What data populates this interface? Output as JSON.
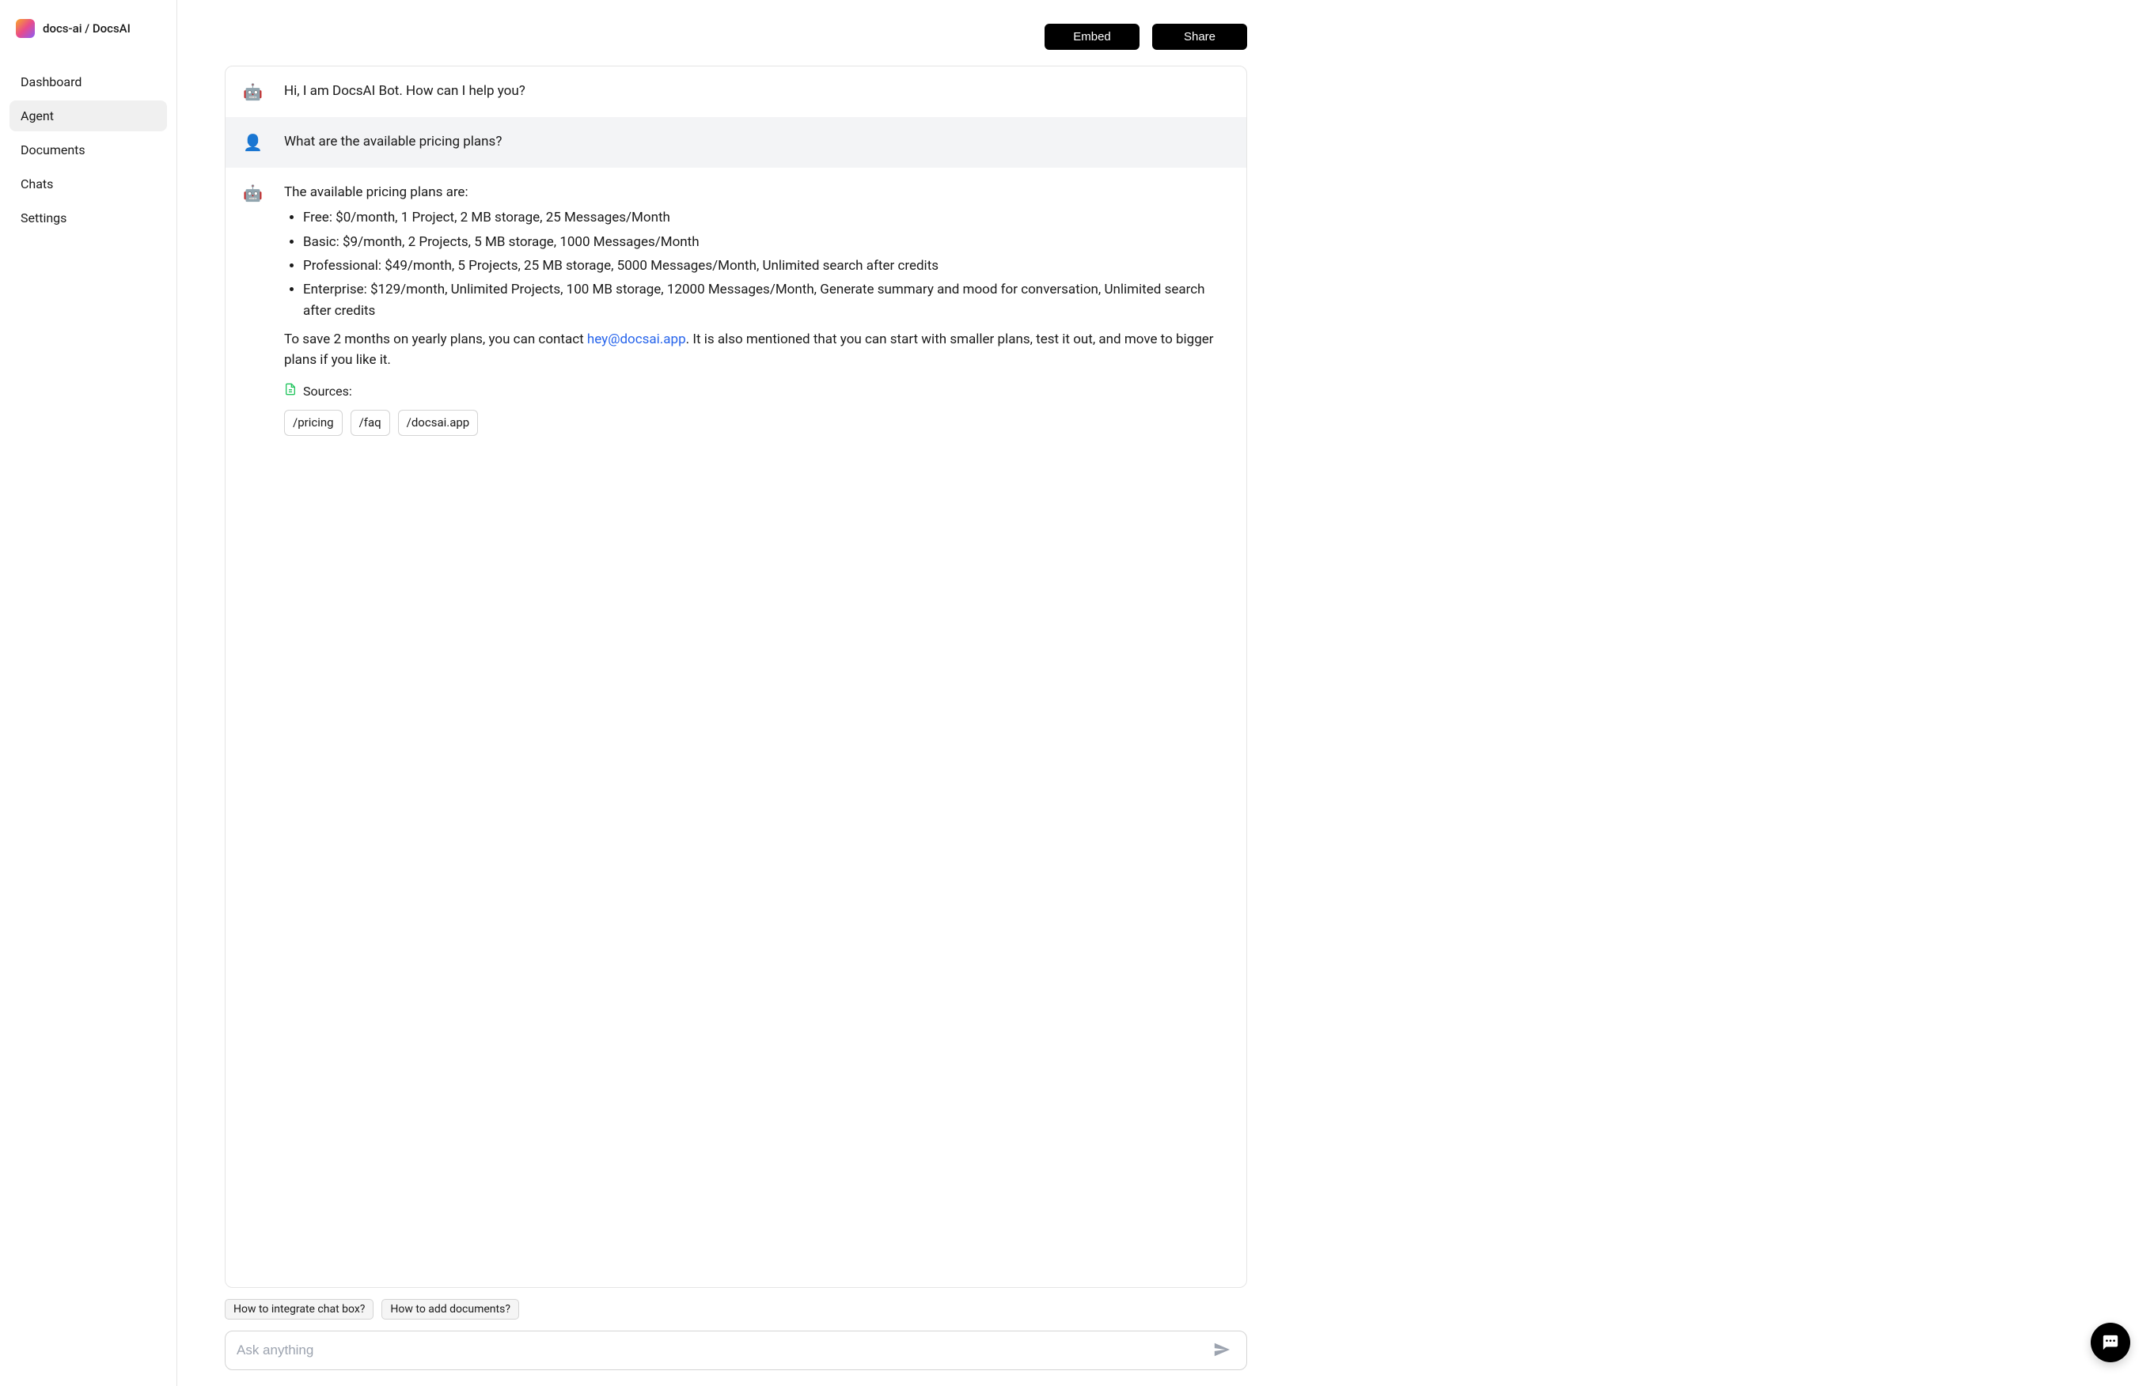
{
  "header": {
    "breadcrumb": "docs-ai / DocsAI"
  },
  "sidebar": {
    "items": [
      {
        "label": "Dashboard",
        "active": false
      },
      {
        "label": "Agent",
        "active": true
      },
      {
        "label": "Documents",
        "active": false
      },
      {
        "label": "Chats",
        "active": false
      },
      {
        "label": "Settings",
        "active": false
      }
    ]
  },
  "actions": {
    "embed": "Embed",
    "share": "Share"
  },
  "chat": {
    "bot_icon": "🤖",
    "user_icon": "👤",
    "messages": [
      {
        "role": "bot",
        "text": "Hi, I am DocsAI Bot. How can I help you?"
      },
      {
        "role": "user",
        "text": "What are the available pricing plans?"
      },
      {
        "role": "bot",
        "intro": "The available pricing plans are:",
        "list": [
          "Free: $0/month, 1 Project, 2 MB storage, 25 Messages/Month",
          "Basic: $9/month, 2 Projects, 5 MB storage, 1000 Messages/Month",
          "Professional: $49/month, 5 Projects, 25 MB storage, 5000 Messages/Month, Unlimited search after credits",
          "Enterprise: $129/month, Unlimited Projects, 100 MB storage, 12000 Messages/Month, Generate summary and mood for conversation, Unlimited search after credits"
        ],
        "outro_pre": "To save 2 months on yearly plans, you can contact ",
        "outro_link": "hey@docsai.app",
        "outro_post": ". It is also mentioned that you can start with smaller plans, test it out, and move to bigger plans if you like it.",
        "sources_label": "Sources:",
        "sources": [
          "/pricing",
          "/faq",
          "/docsai.app"
        ]
      }
    ]
  },
  "suggestions": [
    "How to integrate chat box?",
    "How to add documents?"
  ],
  "input": {
    "placeholder": "Ask anything"
  }
}
